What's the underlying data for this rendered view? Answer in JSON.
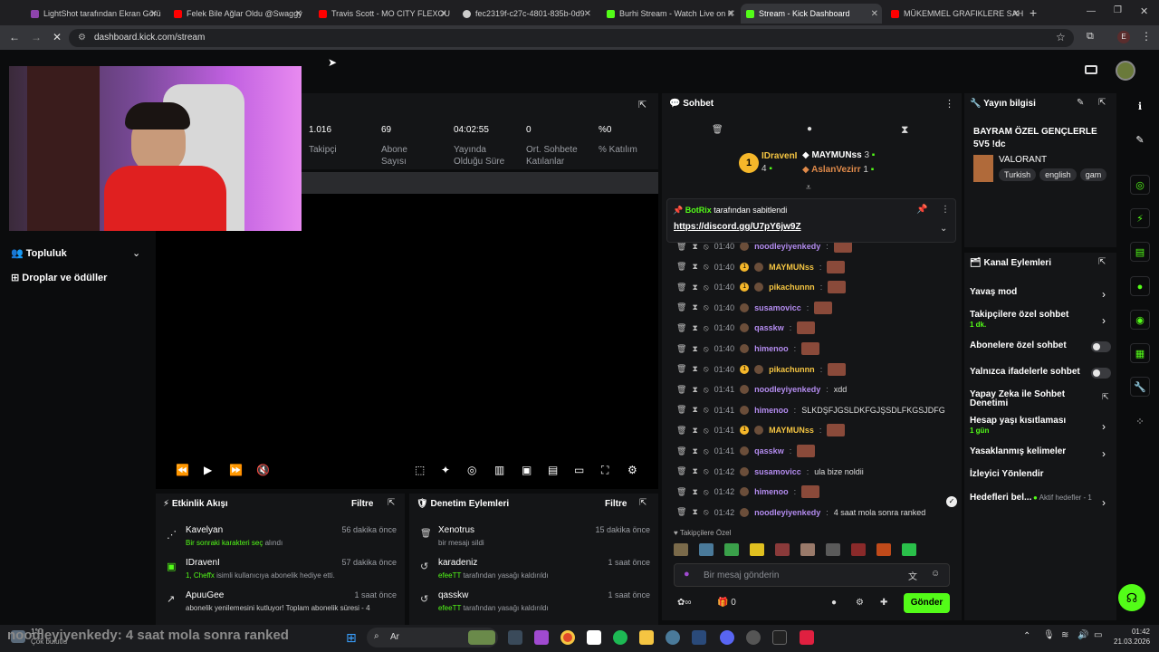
{
  "tabs": [
    {
      "label": "LightShot tarafından Ekran Görü",
      "color": "#8e44ad"
    },
    {
      "label": "Felek Bile Ağlar Oldu @Swaggy",
      "color": "#ff0000"
    },
    {
      "label": "Travis Scott - MO CITY FLEXOU",
      "color": "#ff0000"
    },
    {
      "label": "fec2319f-c27c-4801-835b-0d9",
      "color": "#cccccc"
    },
    {
      "label": "Burhi Stream - Watch Live on K",
      "color": "#53fc18"
    },
    {
      "label": "Stream - Kick Dashboard",
      "color": "#53fc18"
    },
    {
      "label": "MÜKEMMEL GRAFIKLERE SAHİ",
      "color": "#ff0000"
    }
  ],
  "url": "dashboard.kick.com/stream",
  "stats": [
    {
      "num": "1.016",
      "label": "Takipçi"
    },
    {
      "num": "69",
      "label": "Abone Sayısı"
    },
    {
      "num": "04:02:55",
      "label": "Yayında Olduğu Süre"
    },
    {
      "num": "0",
      "label": "Ort. Sohbete Katılanlar"
    },
    {
      "num": "%0",
      "label": "% Katılım"
    }
  ],
  "sidebar": {
    "community": "Topluluk",
    "drops": "Droplar ve ödüller"
  },
  "activity": {
    "title": "Etkinlik Akışı",
    "filter": "Filtre",
    "items": [
      {
        "user": "Kavelyan",
        "time": "56 dakika önce",
        "detail": "Bir sonraki karakteri seç",
        "detail2": "alındı"
      },
      {
        "user": "IDravenI",
        "time": "57 dakika önce",
        "detail": "1, Cheffx",
        "detail2": "isimli kullanıcıya abonelik hediye etti."
      },
      {
        "user": "ApuuGee",
        "time": "1 saat önce",
        "detail": "abonelik yenilemesini kutluyor! Toplam abonelik süresi - 4",
        "detail2": ""
      }
    ]
  },
  "moderation": {
    "title": "Denetim Eylemleri",
    "filter": "Filtre",
    "items": [
      {
        "user": "Xenotrus",
        "time": "15 dakika önce",
        "detail": "bir mesajı sildi",
        "actor": ""
      },
      {
        "user": "karadeniz",
        "time": "1 saat önce",
        "actor": "efeeTT",
        "detail": "tarafından yasağı kaldırıldı"
      },
      {
        "user": "qasskw",
        "time": "1 saat önce",
        "actor": "efeeTT",
        "detail": "tarafından yasağı kaldırıldı"
      }
    ]
  },
  "chat": {
    "title": "Sohbet",
    "top": [
      {
        "name": "IDravenI",
        "count": "4"
      },
      {
        "name": "MAYMUNss",
        "count": "3"
      },
      {
        "name": "AslanVezirr",
        "count": "1"
      }
    ],
    "pinned_by": "BotRix",
    "pinned_suffix": "tarafından sabitlendi",
    "pinned_link": "https://discord.gg/U7pY6jw9Z",
    "messages": [
      {
        "time": "01:40",
        "user": "noodleyiyenkedy",
        "msg": "",
        "emote": true
      },
      {
        "time": "01:40",
        "user": "MAYMUNss",
        "msg": "",
        "emote": true,
        "gold": true
      },
      {
        "time": "01:40",
        "user": "pikachunnn",
        "msg": "",
        "emote": true,
        "gold": true
      },
      {
        "time": "01:40",
        "user": "susamovicc",
        "msg": "",
        "emote": true
      },
      {
        "time": "01:40",
        "user": "qasskw",
        "msg": "",
        "emote": true
      },
      {
        "time": "01:40",
        "user": "himenoo",
        "msg": "",
        "emote": true
      },
      {
        "time": "01:40",
        "user": "pikachunnn",
        "msg": "",
        "emote": true,
        "gold": true
      },
      {
        "time": "01:41",
        "user": "noodleyiyenkedy",
        "msg": "xdd",
        "emote": false
      },
      {
        "time": "01:41",
        "user": "himenoo",
        "msg": "SLKDŞFJGSLDKFGJŞSDLFKGSJDFG",
        "emote": false
      },
      {
        "time": "01:41",
        "user": "MAYMUNss",
        "msg": "",
        "emote": true,
        "gold": true
      },
      {
        "time": "01:41",
        "user": "qasskw",
        "msg": "",
        "emote": true
      },
      {
        "time": "01:42",
        "user": "susamovicc",
        "msg": "ula bize noldii",
        "emote": false
      },
      {
        "time": "01:42",
        "user": "himenoo",
        "msg": "",
        "emote": true
      },
      {
        "time": "01:42",
        "user": "noodleyiyenkedy",
        "msg": "4 saat mola sonra ranked",
        "emote": false
      }
    ],
    "followers_only": "Takipçilere Özel",
    "input_placeholder": "Bir mesaj gönderin",
    "send": "Gönder",
    "count": "0"
  },
  "stream_info": {
    "title": "Yayın bilgisi",
    "stream_title": "BAYRAM ÖZEL GENÇLERLE 5V5 !dc",
    "game": "VALORANT",
    "tags": [
      "Turkish",
      "english",
      "gam"
    ]
  },
  "channel_actions": {
    "title": "Kanal Eylemleri",
    "items": [
      {
        "label": "Yavaş mod",
        "sub": "",
        "type": "arrow"
      },
      {
        "label": "Takipçilere özel sohbet",
        "sub": "1 dk.",
        "type": "arrow"
      },
      {
        "label": "Abonelere özel sohbet",
        "sub": "",
        "type": "toggle"
      },
      {
        "label": "Yalnızca ifadelerle sohbet",
        "sub": "",
        "type": "toggle"
      },
      {
        "label": "Yapay Zeka ile Sohbet Denetimi",
        "sub": "",
        "type": "ext"
      },
      {
        "label": "Hesap yaşı kısıtlaması",
        "sub": "1 gün",
        "type": "arrow"
      },
      {
        "label": "Yasaklanmış kelimeler",
        "sub": "",
        "type": "arrow"
      },
      {
        "label": "İzleyici Yönlendir",
        "sub": "",
        "type": "none"
      },
      {
        "label": "Hedefleri bel...",
        "sub": "Aktif hedefler - 1",
        "type": "arrow"
      }
    ]
  },
  "overlay_text": "noodleyiyenkedy: 4 saat mola sonra ranked",
  "taskbar": {
    "weather_temp": "1°C",
    "weather_desc": "Çok bulutlu",
    "search": "Ara",
    "time": "01:42",
    "date": "21.03.2026"
  }
}
